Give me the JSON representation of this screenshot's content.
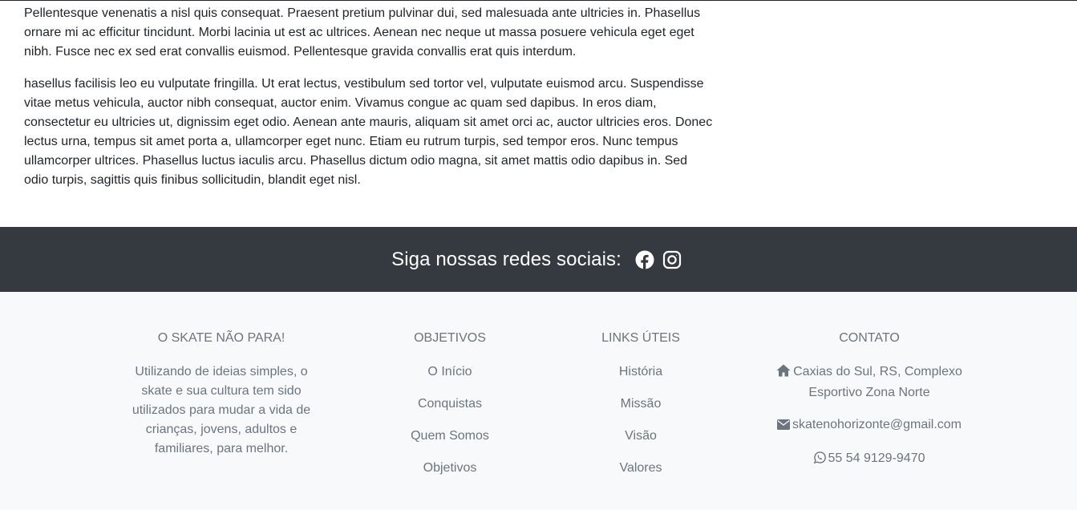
{
  "article": {
    "p1": "Pellentesque venenatis a nisl quis consequat. Praesent pretium pulvinar dui, sed malesuada ante ultricies in. Phasellus ornare mi ac efficitur tincidunt. Morbi lacinia ut est ac ultrices. Aenean nec neque ut massa posuere vehicula eget eget nibh. Fusce nec ex sed erat convallis euismod. Pellentesque gravida convallis erat quis interdum.",
    "p2": "hasellus facilisis leo eu vulputate fringilla. Ut erat lectus, vestibulum sed tortor vel, vulputate euismod arcu. Suspendisse vitae metus vehicula, auctor nibh consequat, auctor enim. Vivamus congue ac quam sed dapibus. In eros diam, consectetur eu ultricies ut, dignissim eget odio. Aenean ante mauris, aliquam sit amet orci ac, auctor ultricies eros. Donec lectus urna, tempus sit amet porta a, ullamcorper eget nunc. Etiam eu rutrum turpis, sed tempor eros. Nunc tempus ullamcorper ultrices. Phasellus luctus iaculis arcu. Phasellus dictum odio magna, sit amet mattis odio dapibus in. Sed odio turpis, sagittis quis finibus sollicitudin, blandit eget nisl."
  },
  "social": {
    "title": "Siga nossas redes sociais:",
    "icons": [
      "facebook-icon",
      "instagram-icon"
    ]
  },
  "footer": {
    "about": {
      "heading": "O SKATE NÃO PARA!",
      "text": "Utilizando de ideias simples, o skate e sua cultura tem sido utilizados para mudar a vida de crianças, jovens, adultos e familiares, para melhor."
    },
    "objetivos": {
      "heading": "OBJETIVOS",
      "links": [
        "O Início",
        "Conquistas",
        "Quem Somos",
        "Objetivos"
      ]
    },
    "links_uteis": {
      "heading": "LINKS ÚTEIS",
      "links": [
        "História",
        "Missão",
        "Visão",
        "Valores"
      ]
    },
    "contato": {
      "heading": "CONTATO",
      "address": "Caxias do Sul, RS, Complexo Esportivo Zona Norte",
      "email": "skatenohorizonte@gmail.com",
      "phone": "55 54 9129-9470"
    }
  },
  "colors": {
    "social_bar": "#343a40",
    "footer_bg": "#f8f9fa",
    "muted_text": "#6c757d"
  }
}
